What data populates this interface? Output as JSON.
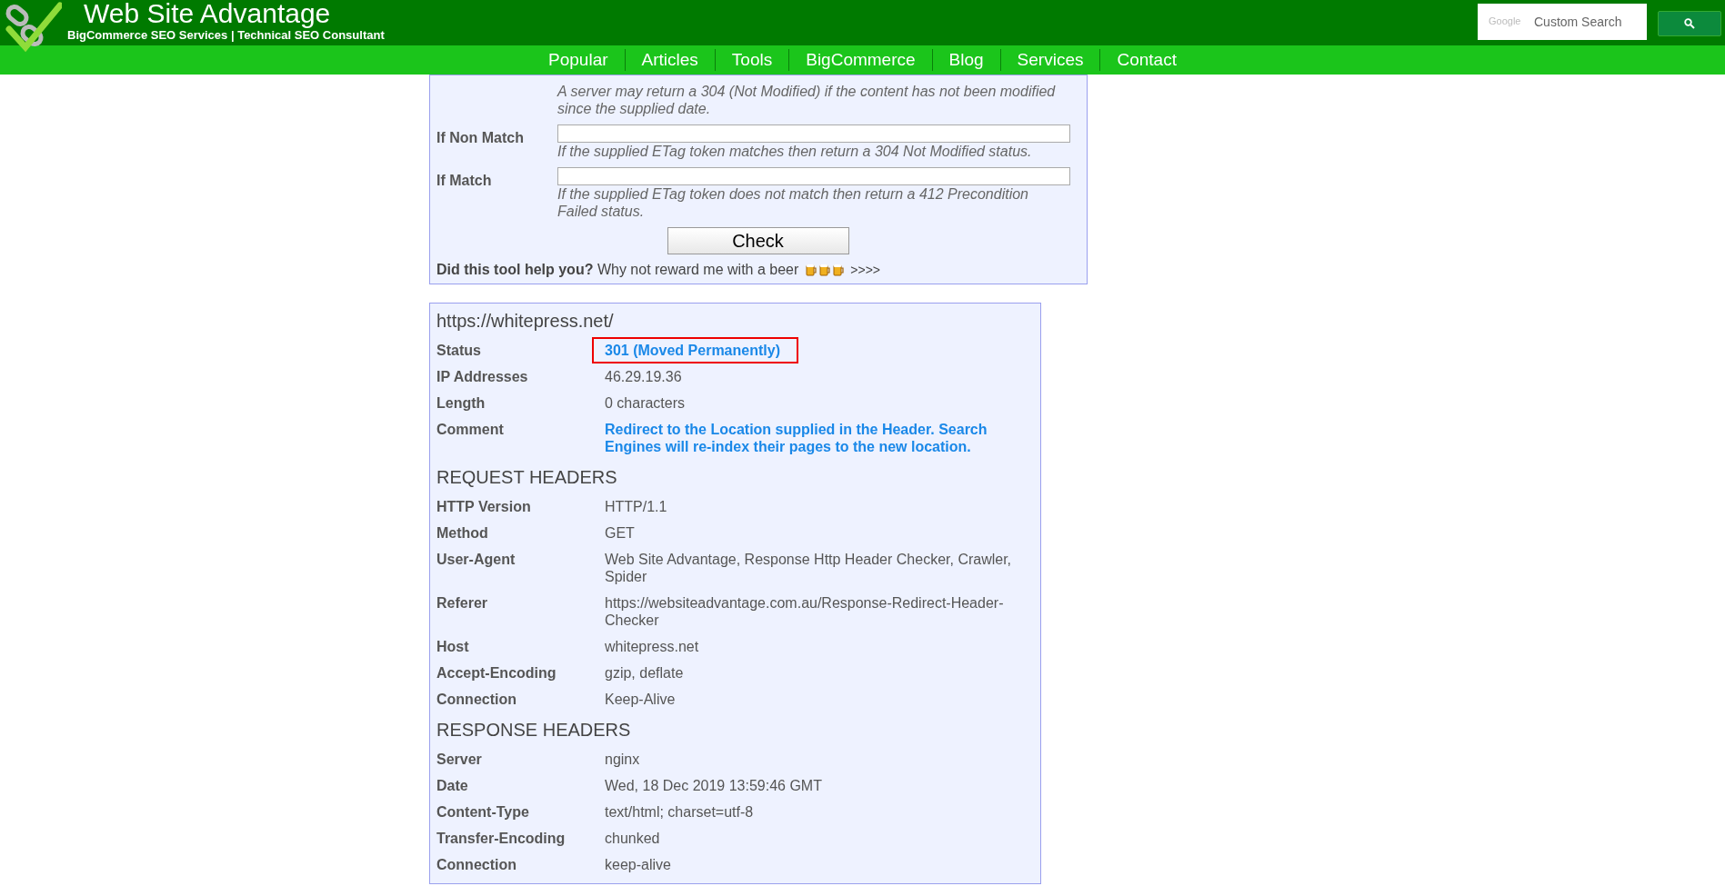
{
  "header": {
    "title": "Web Site Advantage",
    "tagline": "BigCommerce SEO Services | Technical SEO Consultant",
    "search": {
      "brand": "Google",
      "placeholder": "Custom Search"
    }
  },
  "nav": [
    "Popular",
    "Articles",
    "Tools",
    "BigCommerce",
    "Blog",
    "Services",
    "Contact"
  ],
  "form": {
    "top_hint": "A server may return a 304 (Not Modified) if the content has not been modified since the supplied date.",
    "fields": [
      {
        "label": "If Non Match",
        "hint": "If the supplied ETag token matches then return a 304 Not Modified status."
      },
      {
        "label": "If Match",
        "hint": "If the supplied ETag token does not match then return a 412 Precondition Failed status."
      }
    ],
    "button": "Check",
    "reward": "**Did this tool help you?** Why not reward me with a beer",
    "reward_arrows": ">>>>"
  },
  "result": {
    "url": "https://whitepress.net/",
    "sections": [
      {
        "rows": [
          {
            "label": "Status",
            "value": "301 (Moved Permanently)",
            "kind": "link",
            "highlighted": true
          },
          {
            "label": "IP Addresses",
            "value": "46.29.19.36",
            "kind": "plain",
            "highlighted": false
          },
          {
            "label": "Length",
            "value": "0 characters",
            "kind": "plain",
            "highlighted": false
          },
          {
            "label": "Comment",
            "value": "Redirect to the Location supplied in the Header. Search Engines will re-index their pages to the new location.",
            "kind": "link",
            "highlighted": false
          }
        ]
      },
      {
        "heading": "REQUEST HEADERS",
        "rows": [
          {
            "label": "HTTP Version",
            "value": "HTTP/1.1",
            "kind": "plain",
            "highlighted": false
          },
          {
            "label": "Method",
            "value": "GET",
            "kind": "plain",
            "highlighted": false
          },
          {
            "label": "User-Agent",
            "value": "Web Site Advantage, Response Http Header Checker, Crawler, Spider",
            "kind": "plain",
            "highlighted": false
          },
          {
            "label": "Referer",
            "value": "https://websiteadvantage.com.au/Response-Redirect-Header-Checker",
            "kind": "plain",
            "highlighted": false
          },
          {
            "label": "Host",
            "value": "whitepress.net",
            "kind": "plain",
            "highlighted": false
          },
          {
            "label": "Accept-Encoding",
            "value": "gzip, deflate",
            "kind": "plain",
            "highlighted": false
          },
          {
            "label": "Connection",
            "value": "Keep-Alive",
            "kind": "plain",
            "highlighted": false
          }
        ]
      },
      {
        "heading": "RESPONSE HEADERS",
        "rows": [
          {
            "label": "Server",
            "value": "nginx",
            "kind": "plain",
            "highlighted": false
          },
          {
            "label": "Date",
            "value": "Wed, 18 Dec 2019 13:59:46 GMT",
            "kind": "plain",
            "highlighted": false
          },
          {
            "label": "Content-Type",
            "value": "text/html; charset=utf-8",
            "kind": "plain",
            "highlighted": false
          },
          {
            "label": "Transfer-Encoding",
            "value": "chunked",
            "kind": "plain",
            "highlighted": false
          },
          {
            "label": "Connection",
            "value": "keep-alive",
            "kind": "plain",
            "highlighted": false
          }
        ]
      }
    ]
  }
}
